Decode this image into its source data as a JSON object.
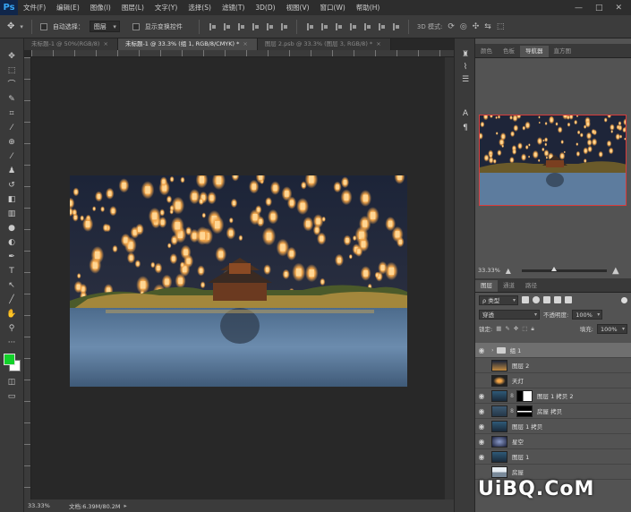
{
  "app": {
    "logo": "Ps"
  },
  "menu": [
    "文件(F)",
    "编辑(E)",
    "图像(I)",
    "图层(L)",
    "文字(Y)",
    "选择(S)",
    "滤镜(T)",
    "3D(D)",
    "视图(V)",
    "窗口(W)",
    "帮助(H)"
  ],
  "window_controls": {
    "minimize": "—",
    "maximize": "□",
    "close": "✕"
  },
  "options": {
    "auto_select_label": "自动选择：",
    "auto_select_value": "图层",
    "show_transform_label": "显示变换控件"
  },
  "tabs": [
    {
      "label": "未标题-1 @ 50%(RGB/8)",
      "close": "×",
      "active": false
    },
    {
      "label": "未标题-1 @ 33.3% (组 1, RGB/8/CMYK) *",
      "close": "×",
      "active": true
    },
    {
      "label": "图层 2.psb @ 33.3% (图层 3, RGB/8) *",
      "close": "×",
      "active": false
    }
  ],
  "status": {
    "zoom": "33.33%",
    "doc": "文档:6.39M/80.2M"
  },
  "tools": [
    "move-icon",
    "marquee-icon",
    "lasso-icon",
    "quick-select-icon",
    "crop-icon",
    "eyedropper-icon",
    "healing-icon",
    "brush-icon",
    "stamp-icon",
    "history-brush-icon",
    "eraser-icon",
    "gradient-icon",
    "blur-icon",
    "dodge-icon",
    "pen-icon",
    "type-icon",
    "path-select-icon",
    "line-icon",
    "hand-icon",
    "zoom-icon",
    "more-icon"
  ],
  "colors": {
    "foreground": "#12d12a",
    "background": "#ffffff",
    "nav_frame": "#d83b3b"
  },
  "panel_tabs_top": [
    {
      "label": "颜色",
      "active": false
    },
    {
      "label": "色板",
      "active": false
    },
    {
      "label": "导航器",
      "active": true
    },
    {
      "label": "直方图",
      "active": false
    }
  ],
  "navigator": {
    "zoom": "33.33%",
    "zoom_fraction": 0.38
  },
  "layers_tabs": [
    {
      "label": "图层",
      "active": true
    },
    {
      "label": "通道",
      "active": false
    },
    {
      "label": "路径",
      "active": false
    }
  ],
  "layers_panel": {
    "filter_label": "ρ 类型",
    "blend_mode": "穿透",
    "opacity_label": "不透明度:",
    "opacity_value": "100%",
    "lock_label": "锁定:",
    "fill_label": "填充:",
    "fill_value": "100%"
  },
  "layers": [
    {
      "name": "组 1",
      "visible": true,
      "type": "group",
      "selected": true
    },
    {
      "name": "图层 2",
      "visible": false,
      "type": "image"
    },
    {
      "name": "天灯",
      "visible": false,
      "type": "image"
    },
    {
      "name": "图层 1 拷贝 2",
      "visible": true,
      "type": "masked"
    },
    {
      "name": "房屋 拷贝",
      "visible": true,
      "type": "masked"
    },
    {
      "name": "图层 1 拷贝",
      "visible": true,
      "type": "image"
    },
    {
      "name": "星空",
      "visible": true,
      "type": "image"
    },
    {
      "name": "图层 1",
      "visible": true,
      "type": "image"
    },
    {
      "name": "房屋",
      "visible": false,
      "type": "image"
    }
  ],
  "watermark": "UiBQ.CoM"
}
